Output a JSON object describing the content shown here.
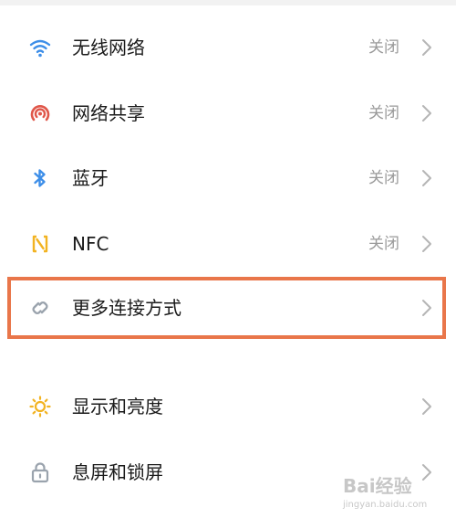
{
  "settings": {
    "items": [
      {
        "label": "无线网络",
        "value": "关闭",
        "icon": "wifi-icon"
      },
      {
        "label": "网络共享",
        "value": "关闭",
        "icon": "hotspot-icon"
      },
      {
        "label": "蓝牙",
        "value": "关闭",
        "icon": "bluetooth-icon"
      },
      {
        "label": "NFC",
        "value": "关闭",
        "icon": "nfc-icon"
      },
      {
        "label": "更多连接方式",
        "value": "",
        "icon": "link-icon"
      },
      {
        "label": "显示和亮度",
        "value": "",
        "icon": "sun-icon"
      },
      {
        "label": "息屏和锁屏",
        "value": "",
        "icon": "lock-icon"
      }
    ]
  },
  "colors": {
    "highlight": "#e9764a",
    "wifi": "#3d8ee8",
    "hotspot": "#e0574a",
    "bluetooth": "#3d8ee8",
    "nfc": "#f2b322",
    "link": "#9aa3ad",
    "sun": "#f2b322",
    "lock": "#9aa3ad"
  },
  "watermark": {
    "text": "Bai经验",
    "url": "jingyan.baidu.com"
  }
}
